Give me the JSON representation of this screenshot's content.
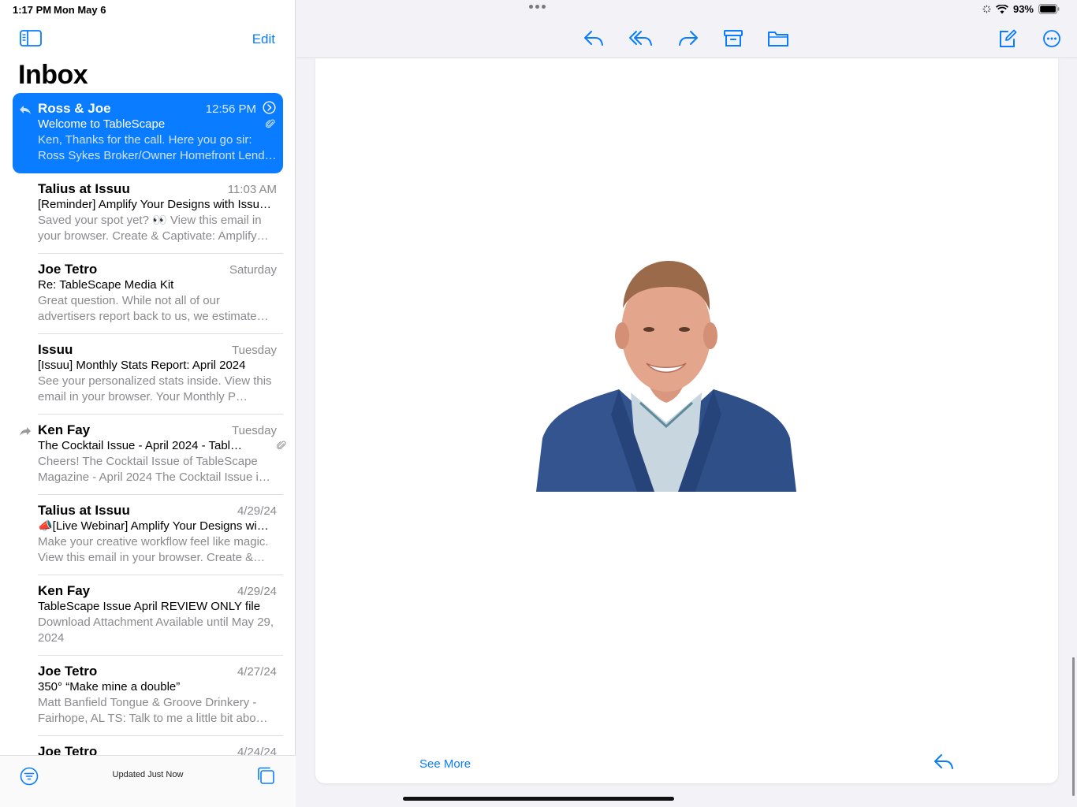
{
  "status": {
    "time": "1:17 PM",
    "date": "Mon May 6",
    "battery": "93%"
  },
  "sidebar": {
    "edit_label": "Edit",
    "title": "Inbox",
    "updated_label": "Updated Just Now"
  },
  "messages": [
    {
      "from": "Ross & Joe",
      "date": "12:56 PM",
      "subject": "Welcome to TableScape",
      "preview": "Ken, Thanks for the call. Here you go sir: Ross Sykes Broker/Owner Homefront Lend…",
      "flag": "replied",
      "attachment": true,
      "selected": true
    },
    {
      "from": "Talius at Issuu",
      "date": "11:03 AM",
      "subject": "[Reminder] Amplify Your Designs with Issu…",
      "preview": "Saved your spot yet? 👀 View this email in your browser. Create & Captivate: Amplify…"
    },
    {
      "from": "Joe Tetro",
      "date": "Saturday",
      "subject": "Re: TableScape Media Kit",
      "preview": "Great question. While not all of our advertisers report back to us, we estimate…"
    },
    {
      "from": "Issuu",
      "date": "Tuesday",
      "subject": "[Issuu] Monthly Stats Report: April 2024",
      "preview": "See your personalized stats inside. View this email in your browser. Your Monthly P…"
    },
    {
      "from": "Ken Fay",
      "date": "Tuesday",
      "subject": "The Cocktail Issue - April 2024 - Tabl…",
      "preview": "Cheers! The Cocktail Issue of TableScape Magazine - April 2024 The Cocktail Issue i…",
      "flag": "forwarded",
      "attachment": true
    },
    {
      "from": "Talius at Issuu",
      "date": "4/29/24",
      "subject": "📣[Live Webinar] Amplify Your Designs wi…",
      "preview": "Make your creative workflow feel like magic. View this email in your browser. Create &…"
    },
    {
      "from": "Ken Fay",
      "date": "4/29/24",
      "subject": "TableScape Issue April REVIEW ONLY file",
      "preview": "Download Attachment Available until May 29, 2024"
    },
    {
      "from": "Joe Tetro",
      "date": "4/27/24",
      "subject": "350°  “Make mine a double”",
      "preview": "Matt Banfield Tongue & Groove Drinkery - Fairhope, AL TS: Talk to me a little bit abo…"
    },
    {
      "from": "Joe Tetro",
      "date": "4/24/24",
      "subject": "",
      "preview": ""
    }
  ],
  "main": {
    "see_more_label": "See More"
  },
  "colors": {
    "accent": "#0a7cff",
    "selected_bg": "#0a7cff"
  }
}
